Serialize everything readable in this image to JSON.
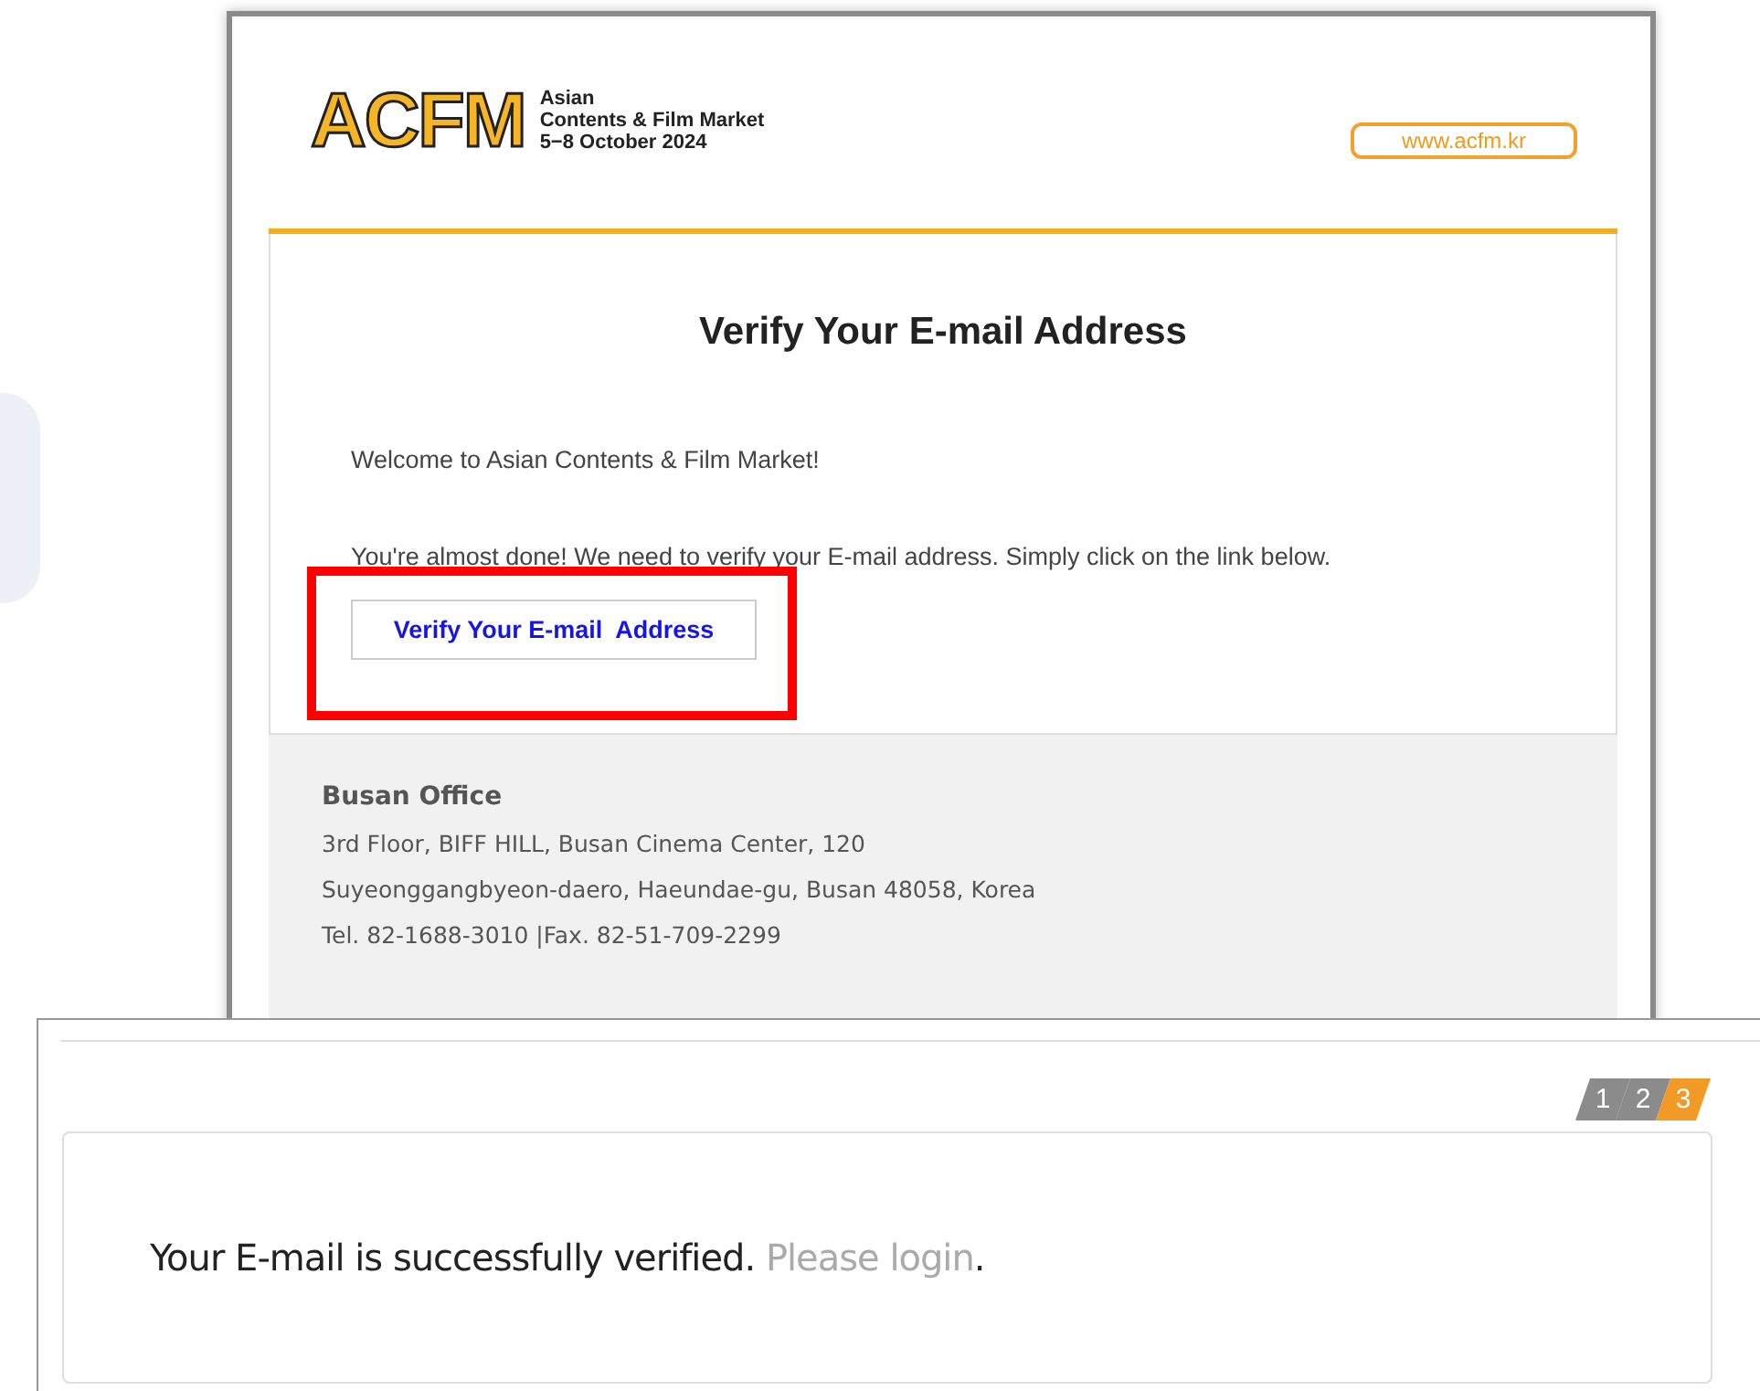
{
  "email": {
    "logo": {
      "wordmark": "ACFM",
      "lines": [
        "Asian",
        "Contents & Film Market",
        "5−8 October 2024"
      ]
    },
    "website_link": "www.acfm.kr",
    "title": "Verify Your E-mail Address",
    "paragraphs": [
      "Welcome to Asian Contents & Film Market!",
      "You're almost done! We need to verify your E-mail address. Simply click on the link below."
    ],
    "verify_button": {
      "label": "Verify Your E-mail  Address",
      "highlighted": true
    },
    "footer": {
      "heading": "Busan Office",
      "lines": [
        "3rd Floor, BIFF HILL, Busan Cinema Center, 120",
        "Suyeonggangbyeon-daero, Haeundae-gu, Busan 48058, Korea",
        "Tel. 82-1688-3010 |Fax. 82-51-709-2299"
      ]
    }
  },
  "result_page": {
    "steps": [
      {
        "label": "1",
        "selected": false
      },
      {
        "label": "2",
        "selected": false
      },
      {
        "label": "3",
        "selected": true
      }
    ],
    "message": "Your E-mail is successfully verified.",
    "login_link": "Please login",
    "end_mark": "."
  }
}
